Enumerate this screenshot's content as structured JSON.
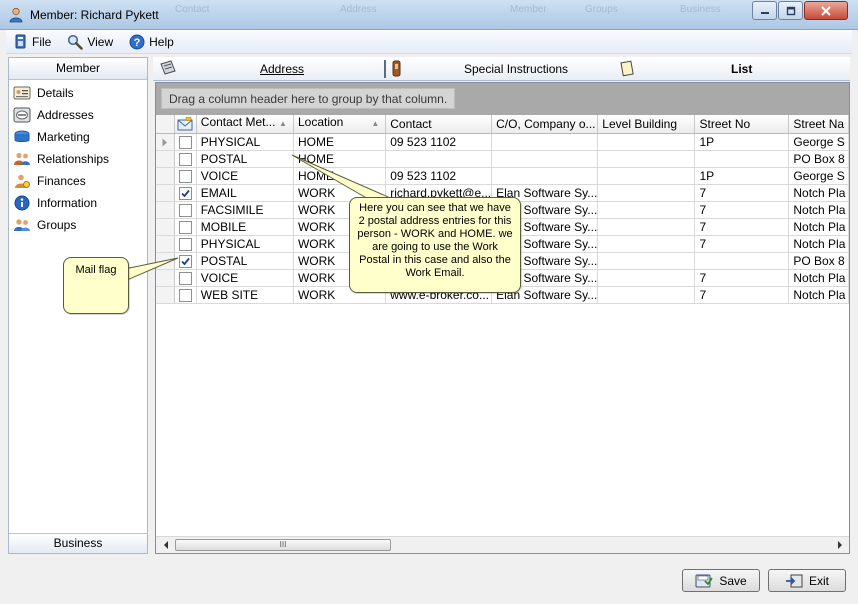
{
  "window": {
    "title": "Member: Richard Pykett",
    "background_labels": [
      "Contact",
      "Address",
      "Member",
      "Groups",
      "Business"
    ]
  },
  "menu": {
    "items": [
      {
        "label": "File",
        "icon": "file-icon"
      },
      {
        "label": "View",
        "icon": "view-icon"
      },
      {
        "label": "Help",
        "icon": "help-icon"
      }
    ]
  },
  "sidebar": {
    "header": "Member",
    "footer": "Business",
    "items": [
      {
        "label": "Details",
        "icon": "details-icon"
      },
      {
        "label": "Addresses",
        "icon": "addresses-icon"
      },
      {
        "label": "Marketing",
        "icon": "marketing-icon"
      },
      {
        "label": "Relationships",
        "icon": "relationships-icon"
      },
      {
        "label": "Finances",
        "icon": "finances-icon"
      },
      {
        "label": "Information",
        "icon": "information-icon"
      },
      {
        "label": "Groups",
        "icon": "groups-icon"
      }
    ]
  },
  "tabs": [
    {
      "label": "Address",
      "icon": "address-book-icon",
      "selected": false
    },
    {
      "label": "Special Instructions",
      "icon": "instructions-icon",
      "selected": false
    },
    {
      "label": "List",
      "icon": "list-icon",
      "selected": true
    }
  ],
  "grid": {
    "group_hint": "Drag a column header here to group by that column.",
    "columns": [
      "Contact Met...",
      "Location",
      "Contact",
      "C/O, Company o...",
      "Level Building",
      "Street No",
      "Street Na"
    ],
    "rows": [
      {
        "mail": false,
        "current": true,
        "cells": [
          "PHYSICAL",
          "HOME",
          "09 523 1102",
          "",
          "",
          "1P",
          "George S"
        ]
      },
      {
        "mail": false,
        "current": false,
        "cells": [
          "POSTAL",
          "HOME",
          "",
          "",
          "",
          "",
          "PO Box 8"
        ]
      },
      {
        "mail": false,
        "current": false,
        "cells": [
          "VOICE",
          "HOME",
          "09 523 1102",
          "",
          "",
          "1P",
          "George S"
        ]
      },
      {
        "mail": true,
        "current": false,
        "cells": [
          "EMAIL",
          "WORK",
          "richard.pykett@e...",
          "Elan Software Sy...",
          "",
          "7",
          "Notch Pla"
        ]
      },
      {
        "mail": false,
        "current": false,
        "cells": [
          "FACSIMILE",
          "WORK",
          "",
          "Elan Software Sy...",
          "",
          "7",
          "Notch Pla"
        ]
      },
      {
        "mail": false,
        "current": false,
        "cells": [
          "MOBILE",
          "WORK",
          "",
          "Elan Software Sy...",
          "",
          "7",
          "Notch Pla"
        ]
      },
      {
        "mail": false,
        "current": false,
        "cells": [
          "PHYSICAL",
          "WORK",
          "",
          "Elan Software Sy...",
          "",
          "7",
          "Notch Pla"
        ]
      },
      {
        "mail": true,
        "current": false,
        "cells": [
          "POSTAL",
          "WORK",
          "",
          "Elan Software Sy...",
          "",
          "",
          "PO Box 8"
        ]
      },
      {
        "mail": false,
        "current": false,
        "cells": [
          "VOICE",
          "WORK",
          "",
          "Elan Software Sy...",
          "",
          "7",
          "Notch Pla"
        ]
      },
      {
        "mail": false,
        "current": false,
        "cells": [
          "WEB SITE",
          "WORK",
          "www.e-broker.co...",
          "Elan Software Sy...",
          "",
          "7",
          "Notch Pla"
        ]
      }
    ],
    "scroll_grip": "III"
  },
  "callouts": {
    "mail_flag": "Mail flag",
    "explanation": "Here you can see that we have 2 postal address entries for this person - WORK and HOME. we are going to use the Work Postal in this case and also the Work Email."
  },
  "buttons": {
    "save": "Save",
    "exit": "Exit"
  }
}
